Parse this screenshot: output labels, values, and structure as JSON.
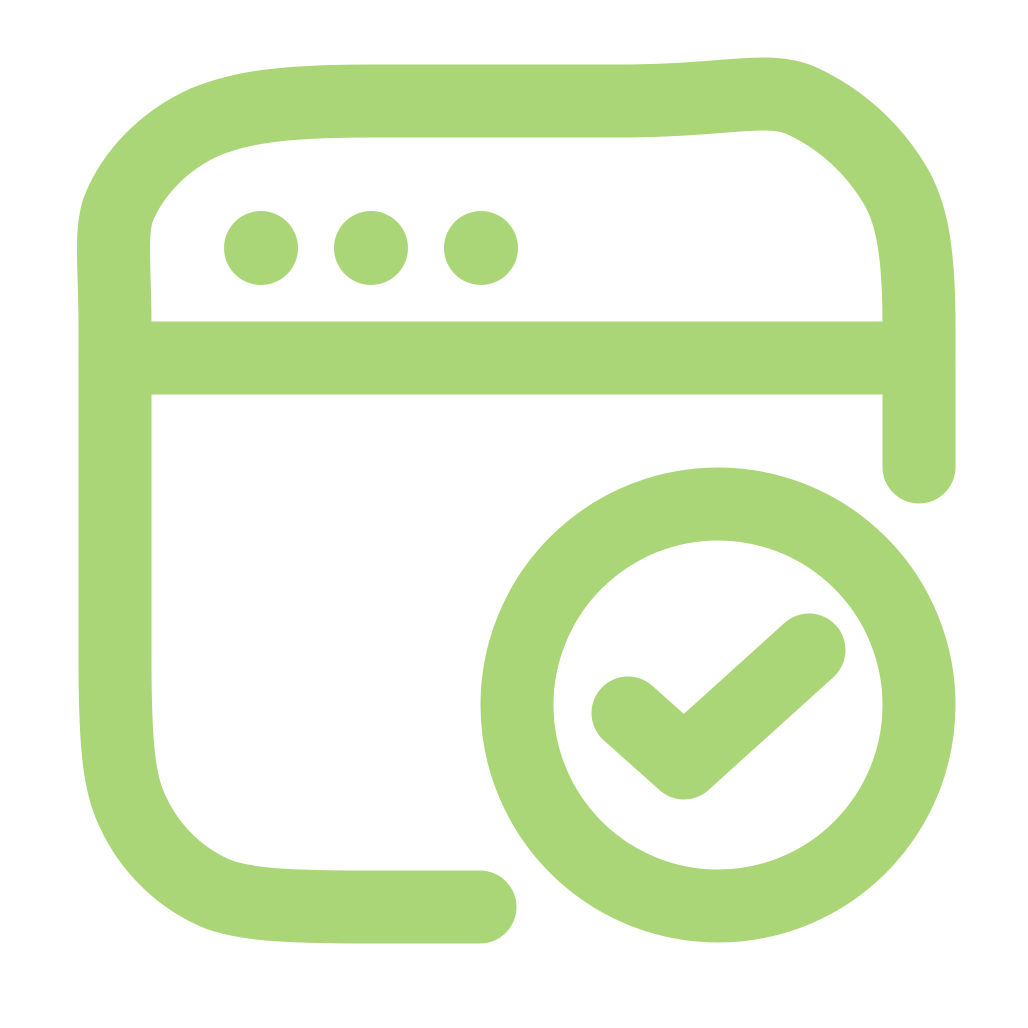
{
  "icon": {
    "name": "browser-window-check-icon",
    "color": "#abd678",
    "background": "#ffffff",
    "window_dots": 3
  }
}
